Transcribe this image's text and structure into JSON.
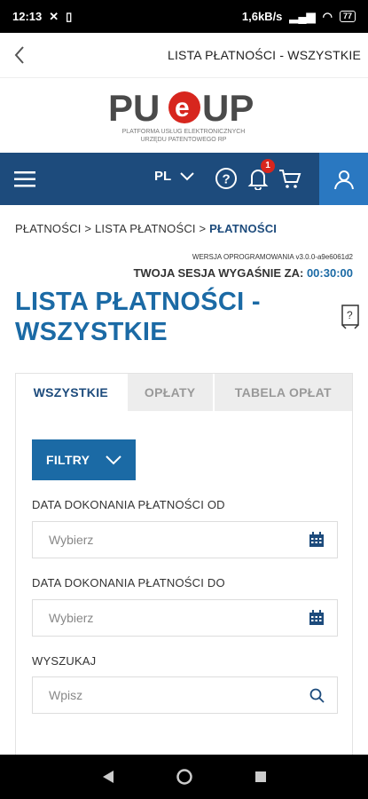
{
  "status_bar": {
    "time": "12:13",
    "network_speed": "1,6kB/s",
    "battery": "77"
  },
  "topbar": {
    "title": "LISTA PŁATNOŚCI - WSZYSTKIE"
  },
  "logo": {
    "wordmark": "PUeUP",
    "subtitle_line1": "PLATFORMA USŁUG ELEKTRONICZNYCH",
    "subtitle_line2": "URZĘDU PATENTOWEGO RP"
  },
  "nav": {
    "language": "PL",
    "notification_count": "1"
  },
  "breadcrumb": {
    "item1": "PŁATNOŚCI",
    "item2": "LISTA PŁATNOŚCI",
    "item3": "PŁATNOŚCI",
    "separator": ">"
  },
  "version": "WERSJA OPROGRAMOWANIA v3.0.0-a9e6061d2",
  "session": {
    "label": "TWOJA SESJA WYGAŚNIE ZA:",
    "timer": "00:30:00"
  },
  "page_title": "LISTA PŁATNOŚCI - WSZYSTKIE",
  "tabs": [
    {
      "label": "WSZYSTKIE"
    },
    {
      "label": "OPŁATY"
    },
    {
      "label": "TABELA OPŁAT"
    }
  ],
  "filters": {
    "button_label": "FILTRY"
  },
  "form": {
    "date_from_label": "DATA DOKONANIA PŁATNOŚCI OD",
    "date_from_placeholder": "Wybierz",
    "date_to_label": "DATA DOKONANIA PŁATNOŚCI DO",
    "date_to_placeholder": "Wybierz",
    "search_label": "WYSZUKAJ",
    "search_placeholder": "Wpisz"
  },
  "colors": {
    "navbar": "#1d4b7c",
    "accent": "#1b6aa5",
    "user_button": "#2a78c1",
    "badge": "#d7261e"
  }
}
